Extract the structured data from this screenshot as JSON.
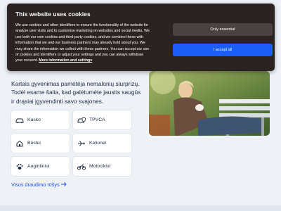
{
  "cookie_banner": {
    "title": "This website uses cookies",
    "body_text": "We use cookies and other identifiers to ensure the functionality of the website for analyse user visits and to customise marketing on websites and social media. We use both our own cookies and third-party cookies, and we combine these with information that we and our business partners may already hold about you. We may share the information we collect with these partners. You can accept our use of cookies and identifiers or adjust your settings and you can always withdraw your consent.",
    "link_text": "More information and settings",
    "only_essential_label": "Only essential",
    "accept_all_label": "I accept all"
  },
  "main": {
    "intro_text": "Kartais gyvenimas pamėtėja nemalonių siurprizų. Todėl esame šalia, kad galėtumėte jaustis saugūs ir drąsiai įgyvendinti savo svajones.",
    "insurance_cards": [
      {
        "label": "Kasko",
        "icon": "car-icon"
      },
      {
        "label": "TPVCA",
        "icon": "car-shield-icon"
      },
      {
        "label": "Būstui",
        "icon": "house-icon"
      },
      {
        "label": "Kelionei",
        "icon": "airplane-icon"
      },
      {
        "label": "Augintiniui",
        "icon": "paw-icon"
      },
      {
        "label": "Motociklui",
        "icon": "motorcycle-icon"
      }
    ],
    "all_types_link": "Visos draudimo rūšys"
  },
  "colors": {
    "banner_bg": "#2a2322",
    "accent_blue": "#1a5ef5",
    "page_bg": "#eef2f7"
  }
}
